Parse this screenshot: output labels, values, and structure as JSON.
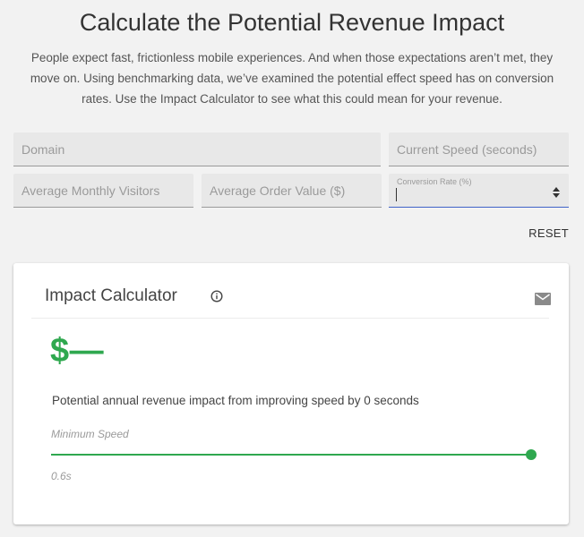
{
  "header": {
    "title": "Calculate the Potential Revenue Impact",
    "intro": "People expect fast, frictionless mobile experiences. And when those expectations aren’t met, they move on. Using benchmarking data, we’ve examined the potential effect speed has on conversion rates. Use the Impact Calculator to see what this could mean for your revenue."
  },
  "form": {
    "domain_placeholder": "Domain",
    "current_speed_placeholder": "Current Speed (seconds)",
    "monthly_visitors_placeholder": "Average Monthly Visitors",
    "order_value_placeholder": "Average Order Value ($)",
    "conversion_rate_label": "Conversion Rate (%)",
    "reset_label": "RESET"
  },
  "card": {
    "title": "Impact Calculator",
    "value": "$—",
    "impact_text": "Potential annual revenue impact from improving speed by 0 seconds",
    "slider_label": "Minimum Speed",
    "slider_value_text": "0.6s",
    "slider_level": 1.0
  },
  "colors": {
    "accent_green": "#2fa84f",
    "focus_blue": "#3f62c7"
  },
  "icons": {
    "info": "info-icon",
    "mail": "mail-icon"
  }
}
